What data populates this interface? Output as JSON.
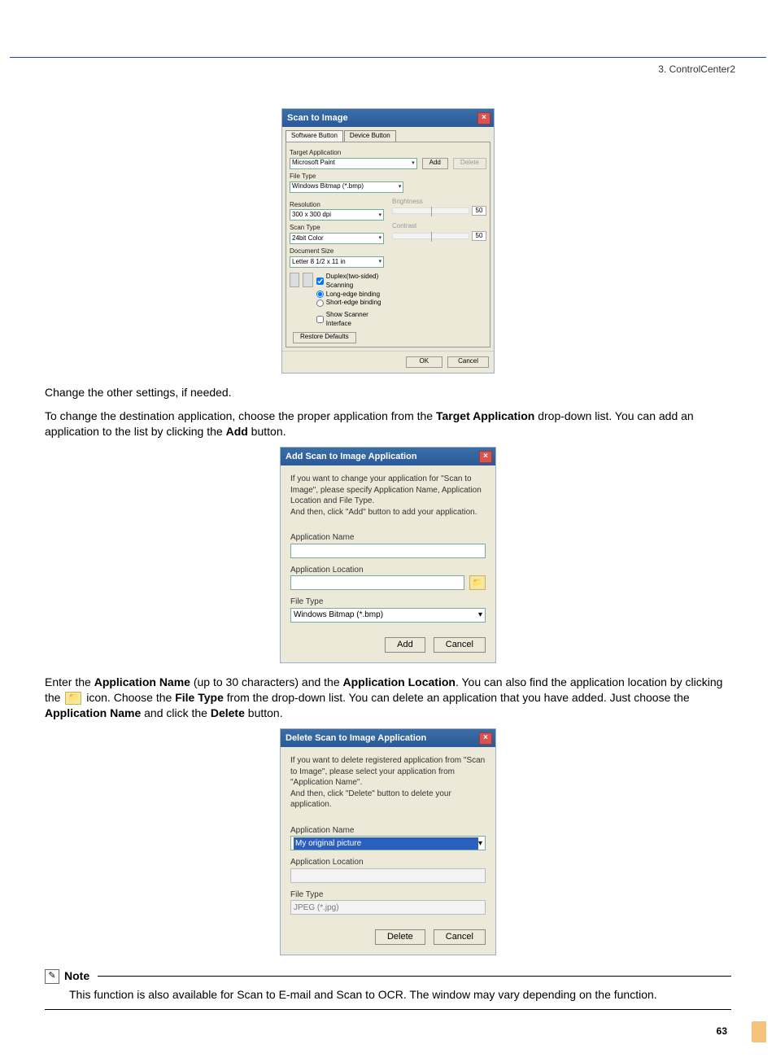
{
  "header": {
    "chapter": "3. ControlCenter2"
  },
  "body": {
    "p1": "Change the other settings, if needed.",
    "p2_a": "To change the destination application, choose the proper application from the ",
    "p2_b": "Target Application",
    "p2_c": " drop-down list. You can add an application to the list by clicking the ",
    "p2_d": "Add",
    "p2_e": " button.",
    "p3_a": "Enter the ",
    "p3_b": "Application Name",
    "p3_c": " (up to 30 characters) and the ",
    "p3_d": "Application Location",
    "p3_e": ". You can also find the application location by clicking the ",
    "p3_f": " icon. Choose the ",
    "p3_g": "File Type",
    "p3_h": " from the drop-down list. You can delete an application that you have added. Just choose the ",
    "p3_i": "Application Name",
    "p3_j": " and click the ",
    "p3_k": "Delete",
    "p3_l": " button."
  },
  "sti": {
    "title": "Scan to Image",
    "tabs": {
      "software": "Software Button",
      "device": "Device Button"
    },
    "targetapp_lbl": "Target Application",
    "targetapp_val": "Microsoft Paint",
    "add": "Add",
    "delete": "Delete",
    "filetype_lbl": "File Type",
    "filetype_val": "Windows Bitmap (*.bmp)",
    "res_lbl": "Resolution",
    "res_val": "300 x 300 dpi",
    "scantype_lbl": "Scan Type",
    "scantype_val": "24bit Color",
    "docsize_lbl": "Document Size",
    "docsize_val": "Letter 8 1/2 x 11 in",
    "bright_lbl": "Brightness",
    "bright_val": "50",
    "contrast_lbl": "Contrast",
    "contrast_val": "50",
    "duplex": "Duplex(two-sided) Scanning",
    "longedge": "Long-edge binding",
    "shortedge": "Short-edge binding",
    "showscan": "Show Scanner Interface",
    "restore": "Restore Defaults",
    "ok": "OK",
    "cancel": "Cancel"
  },
  "add_dlg": {
    "title": "Add Scan to Image Application",
    "intro": "If you want to change your application for \"Scan to Image\", please specify Application Name, Application Location and File Type.\nAnd then, click \"Add\" button to add your application.",
    "appname_lbl": "Application Name",
    "apploc_lbl": "Application Location",
    "filetype_lbl": "File Type",
    "filetype_val": "Windows Bitmap (*.bmp)",
    "add": "Add",
    "cancel": "Cancel"
  },
  "del_dlg": {
    "title": "Delete Scan to Image Application",
    "intro": "If you want to delete registered application from \"Scan to Image\", please select your application from \"Application Name\".\nAnd then, click \"Delete\" button to delete your application.",
    "appname_lbl": "Application Name",
    "appname_val": "My original picture",
    "apploc_lbl": "Application Location",
    "filetype_lbl": "File Type",
    "filetype_val": "JPEG (*.jpg)",
    "delete": "Delete",
    "cancel": "Cancel"
  },
  "note": {
    "label": "Note",
    "text": "This function is also available for Scan to E-mail and Scan to OCR. The window may vary depending on the function."
  },
  "page": {
    "num": "63"
  }
}
